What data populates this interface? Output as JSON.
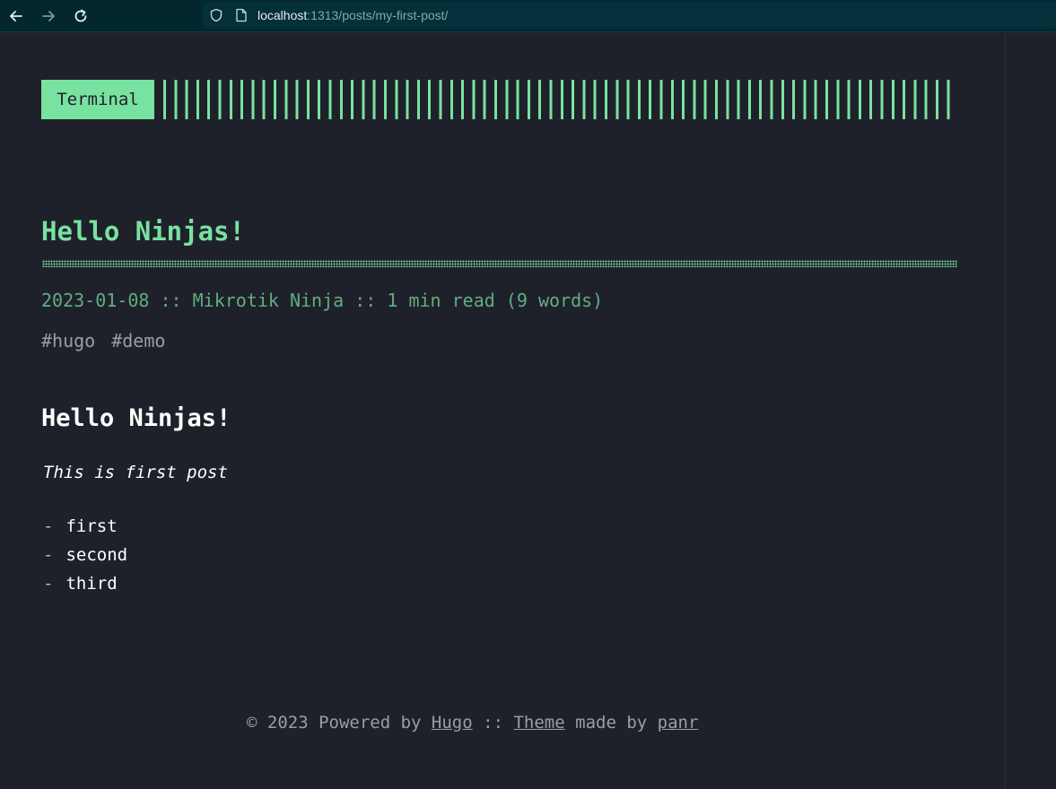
{
  "browser": {
    "url_host": "localhost",
    "url_path": ":1313/posts/my-first-post/"
  },
  "header": {
    "logo_text": "Terminal"
  },
  "post": {
    "title": "Hello Ninjas!",
    "date": "2023-01-08",
    "separator": "::",
    "author": "Mikrotik Ninja",
    "read_time": "1 min read (9 words)",
    "tags": [
      "#hugo",
      "#demo"
    ],
    "content": {
      "heading": "Hello Ninjas!",
      "emphasis": "This is first post",
      "list_items": [
        "first",
        "second",
        "third"
      ]
    }
  },
  "footer": {
    "copyright": "© 2023 Powered by",
    "hugo_link": "Hugo",
    "separator": "::",
    "theme_link": "Theme",
    "made_by": "made by",
    "author_link": "panr"
  },
  "colors": {
    "accent": "#78e2a0",
    "background": "#1f212a",
    "meta": "#5fae7f",
    "muted": "#9a9da6",
    "browser_bar": "#03272e"
  }
}
